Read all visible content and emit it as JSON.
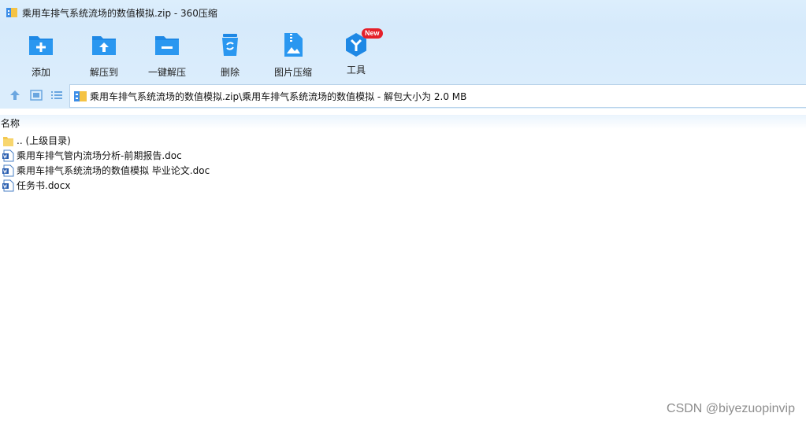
{
  "window": {
    "title": "乘用车排气系统流场的数值模拟.zip - 360压缩"
  },
  "toolbar": {
    "items": [
      {
        "label": "添加",
        "icon": "add-folder-icon"
      },
      {
        "label": "解压到",
        "icon": "extract-to-icon"
      },
      {
        "label": "一键解压",
        "icon": "one-click-extract-icon"
      },
      {
        "label": "删除",
        "icon": "recycle-bin-icon"
      },
      {
        "label": "图片压缩",
        "icon": "image-compress-icon"
      },
      {
        "label": "工具",
        "icon": "tools-icon",
        "badge": "New"
      }
    ]
  },
  "address": {
    "path": "乘用车排气系统流场的数值模拟.zip\\乘用车排气系统流场的数值模拟 - 解包大小为 2.0 MB"
  },
  "columns": {
    "name_header": "名称"
  },
  "files": [
    {
      "name": ".. (上级目录)",
      "type": "parent-folder"
    },
    {
      "name": "乘用车排气管内流场分析-前期报告.doc",
      "type": "word-doc"
    },
    {
      "name": "乘用车排气系统流场的数值模拟 毕业论文.doc",
      "type": "word-doc"
    },
    {
      "name": "任务书.docx",
      "type": "word-doc"
    }
  ],
  "watermark": "CSDN @biyezuopinvip",
  "colors": {
    "accent": "#1e88e5",
    "toolbar_bg": "#d6eafb",
    "badge": "#e5202a"
  }
}
